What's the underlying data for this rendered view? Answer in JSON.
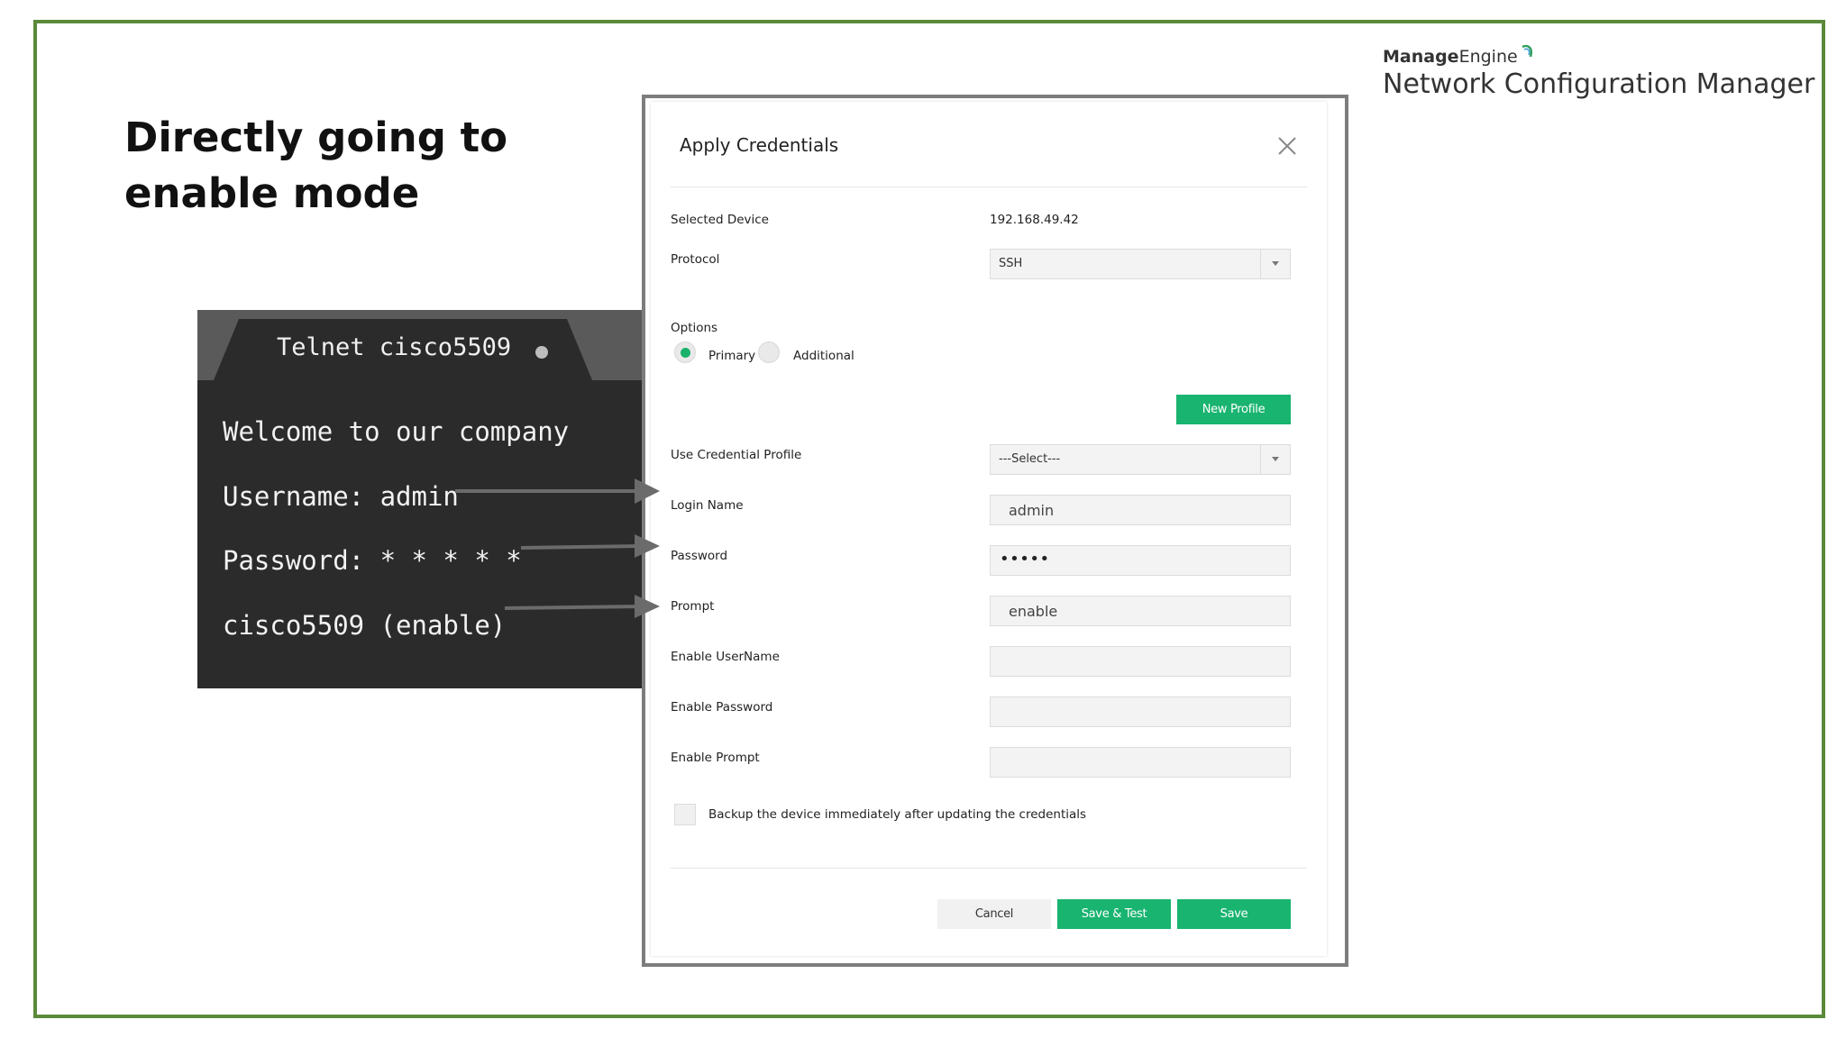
{
  "slide": {
    "headline_line1": "Directly going to",
    "headline_line2": "enable mode",
    "frame_color": "#5a8a3a"
  },
  "brand": {
    "company_part1": "Manage",
    "company_part2": "Engine",
    "product": "Network Configuration Manager"
  },
  "terminal": {
    "tab_title": "Telnet cisco5509",
    "lines": [
      "Welcome to our company",
      "Username: admin",
      "Password: * * * * *",
      "cisco5509 (enable)"
    ]
  },
  "dialog": {
    "title": "Apply Credentials",
    "selected_device_label": "Selected Device",
    "selected_device_value": "192.168.49.42",
    "protocol_label": "Protocol",
    "protocol_value": "SSH",
    "options_label": "Options",
    "option_primary": "Primary",
    "option_additional": "Additional",
    "new_profile_button": "New Profile",
    "credential_profile_label": "Use Credential Profile",
    "credential_profile_value": "---Select---",
    "login_name_label": "Login Name",
    "login_name_value": "admin",
    "password_label": "Password",
    "password_value": "•••••",
    "prompt_label": "Prompt",
    "prompt_value": "enable",
    "enable_username_label": "Enable UserName",
    "enable_username_value": "",
    "enable_password_label": "Enable Password",
    "enable_password_value": "",
    "enable_prompt_label": "Enable Prompt",
    "enable_prompt_value": "",
    "backup_checkbox_label": "Backup the device immediately after updating the credentials",
    "cancel_button": "Cancel",
    "save_test_button": "Save & Test",
    "save_button": "Save",
    "accent_color": "#19b470"
  }
}
